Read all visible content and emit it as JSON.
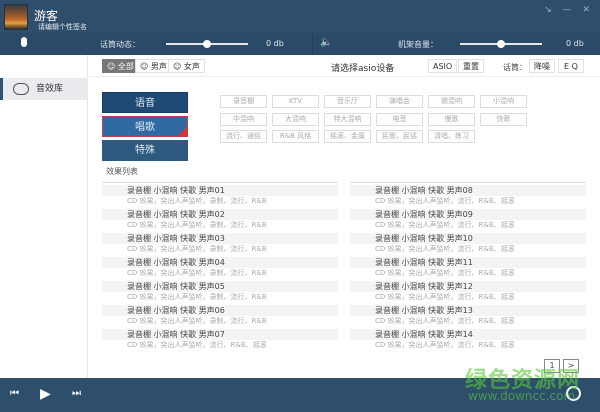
{
  "header": {
    "username": "游客",
    "signature": "请编辑个性签名",
    "window_buttons": "↘ — ✕"
  },
  "controls": {
    "mic_label": "话筒动态：",
    "mic_value": "0 db",
    "mic_level": 0.5,
    "speaker_label": "机架音量：",
    "speaker_value": "0 db",
    "speaker_level": 0.5
  },
  "toolbar": {
    "filters": [
      "全部",
      "男声",
      "女声"
    ],
    "active_filter": "全部",
    "device_prompt": "请选择asio设备",
    "asio": "ASIO",
    "reset": "重置",
    "mic_label": "话筒：",
    "denoise": "降噪",
    "eq": "E Q"
  },
  "sidebar": {
    "items": [
      {
        "label": "音效库"
      }
    ]
  },
  "categories": [
    {
      "label": "语音"
    },
    {
      "label": "唱歌",
      "selected": true
    },
    {
      "label": "特殊"
    }
  ],
  "tags": [
    "录音棚",
    "KTV",
    "音乐厅",
    "演唱会",
    "微混响",
    "小混响",
    "中混响",
    "大混响",
    "特大混响",
    "电音",
    "慢歌",
    "快歌",
    "流行、通俗",
    "R&B 风格",
    "摇滚、金属",
    "民歌、民谣",
    "清唱、练习"
  ],
  "list": {
    "header": "效果列表",
    "left": [
      {
        "title": "录音棚 小混响 快歌  男声01",
        "desc": "CD 效果，突出人声监听，录制、流行、R&B"
      },
      {
        "title": "录音棚 小混响 快歌  男声02",
        "desc": "CD 效果，突出人声监听，录制、流行、R&B"
      },
      {
        "title": "录音棚 小混响 快歌  男声03",
        "desc": "CD 效果，突出人声监听，录制、流行、R&B"
      },
      {
        "title": "录音棚 小混响 快歌  男声04",
        "desc": "CD 效果，突出人声监听，录制、流行、R&B"
      },
      {
        "title": "录音棚 小混响 快歌  男声05",
        "desc": "CD 效果，突出人声监听，录制、流行、R&B"
      },
      {
        "title": "录音棚 小混响 快歌  男声06",
        "desc": "CD 效果，突出人声监听，录制、流行、R&B"
      },
      {
        "title": "录音棚 小混响 快歌  男声07",
        "desc": "CD 效果，突出人声监听，流行、R&B、摇滚"
      }
    ],
    "right": [
      {
        "title": "录音棚 小混响 快歌  男声08",
        "desc": "CD 效果，突出人声监听，流行、R&B、摇滚"
      },
      {
        "title": "录音棚 小混响 快歌  男声09",
        "desc": "CD 效果，突出人声监听，流行、R&B、摇滚"
      },
      {
        "title": "录音棚 小混响 快歌  男声10",
        "desc": "CD 效果，突出人声监听，流行、R&B、摇滚"
      },
      {
        "title": "录音棚 小混响 快歌  男声11",
        "desc": "CD 效果，突出人声监听，流行、R&B、摇滚"
      },
      {
        "title": "录音棚 小混响 快歌  男声12",
        "desc": "CD 效果，突出人声监听，流行、R&B、摇滚"
      },
      {
        "title": "录音棚 小混响 快歌  男声13",
        "desc": "CD 效果，突出人声监听，流行、R&B、摇滚"
      },
      {
        "title": "录音棚 小混响 快歌  男声14",
        "desc": "CD 效果，突出人声监听，流行、R&B、摇滚"
      }
    ]
  },
  "pager": {
    "page": "1",
    "next": ">"
  },
  "player": {
    "prev": "⏮",
    "play": "▶",
    "next": "⏭"
  },
  "watermark": {
    "name": "绿色资源网",
    "url": "www.downcc.com"
  },
  "colors": {
    "header": "#2f4e6c",
    "category_dark": "#1f4a76",
    "category_selected": "#2f6aa3",
    "category_special": "#2f5a80",
    "check": "#d33"
  }
}
